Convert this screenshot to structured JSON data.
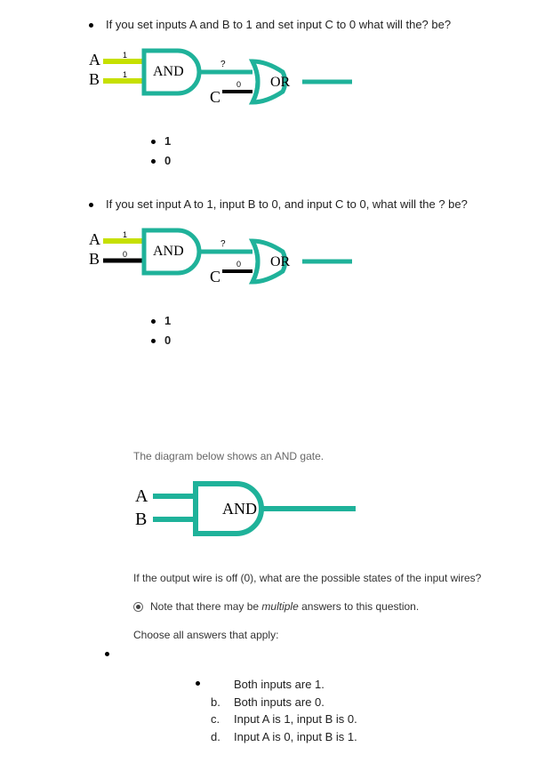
{
  "q1": {
    "prompt": "If you set inputs A and B to 1 and set input C to 0 what will the? be?",
    "labels": {
      "A": "A",
      "B": "B",
      "C": "C",
      "AND": "AND",
      "OR": "OR"
    },
    "wireVals": {
      "A": "1",
      "B": "1",
      "C": "0",
      "andOut": "?"
    },
    "options": {
      "o1": "1",
      "o2": "0"
    }
  },
  "q2": {
    "prompt": "If you set input A to 1, input B to 0, and input C to 0, what will the ? be?",
    "labels": {
      "A": "A",
      "B": "B",
      "C": "C",
      "AND": "AND",
      "OR": "OR"
    },
    "wireVals": {
      "A": "1",
      "B": "0",
      "C": "0",
      "andOut": "?"
    },
    "options": {
      "o1": "1",
      "o2": "0"
    }
  },
  "q3": {
    "caption": "The diagram below shows an AND gate.",
    "labels": {
      "A": "A",
      "B": "B",
      "AND": "AND"
    },
    "question": "If the output wire is off (0), what are the possible states of the input wires?",
    "note_prefix": "Note that there may be ",
    "note_em": "multiple",
    "note_suffix": " answers to this question.",
    "choose": "Choose all answers that apply:",
    "answers": {
      "a": {
        "letter": "",
        "text": "Both inputs are 1."
      },
      "b": {
        "letter": "b.",
        "text": "Both inputs are 0."
      },
      "c": {
        "letter": "c.",
        "text": "Input A is 1, input B is 0."
      },
      "d": {
        "letter": "d.",
        "text": "Input A is 0, input B is 1."
      }
    }
  }
}
